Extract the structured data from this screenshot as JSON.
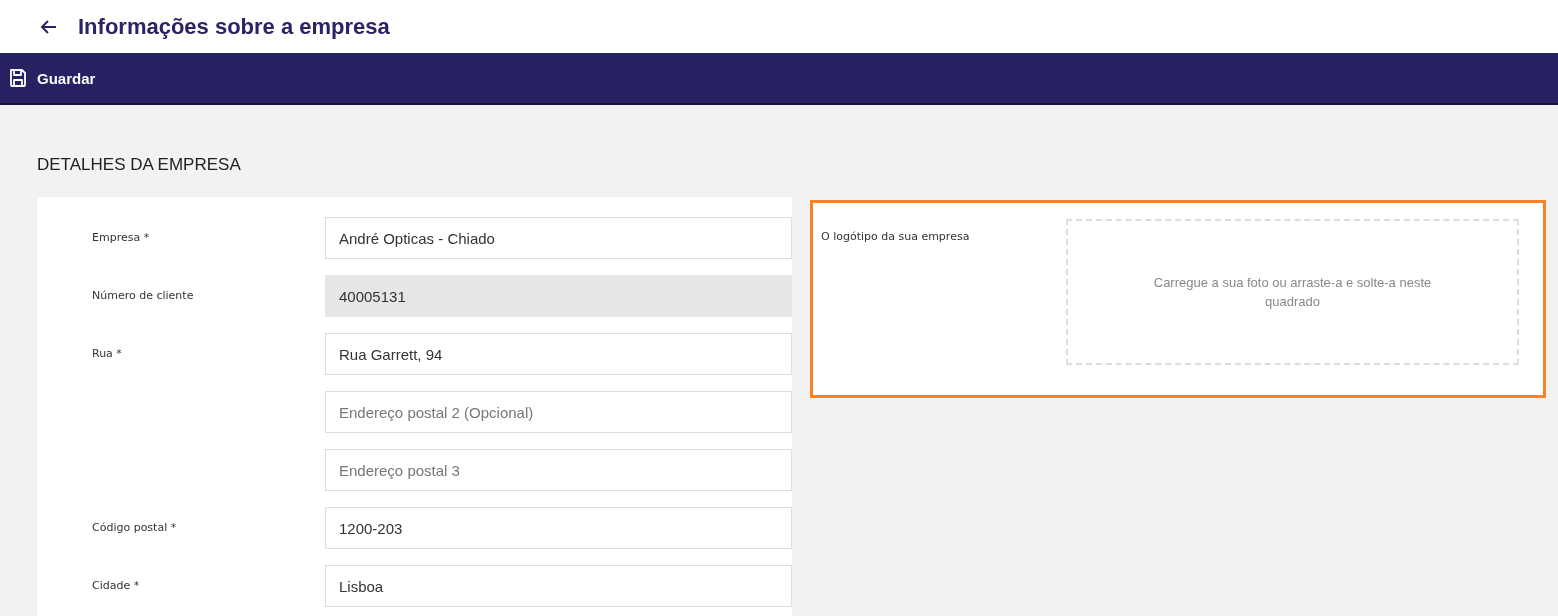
{
  "header": {
    "title": "Informações sobre a empresa"
  },
  "toolbar": {
    "save_label": "Guardar"
  },
  "section": {
    "title": "DETALHES DA EMPRESA"
  },
  "fields": [
    {
      "label": "Empresa *",
      "value": "André Opticas - Chiado",
      "disabled": false
    },
    {
      "label": "Número de cliente",
      "value": "40005131",
      "disabled": true
    },
    {
      "label": "Rua *",
      "value": "Rua Garrett, 94",
      "disabled": false
    },
    {
      "placeholder": "Endereço postal 2 (Opcional)",
      "disabled": false
    },
    {
      "placeholder": "Endereço postal 3",
      "disabled": false
    },
    {
      "label": "Código postal *",
      "value": "1200-203",
      "disabled": false
    },
    {
      "label": "Cidade *",
      "value": "Lisboa",
      "disabled": false
    }
  ],
  "logo": {
    "label": "O logótipo da sua empresa",
    "dropzone_text": "Carregue a sua foto ou arraste-a e solte-a neste quadrado",
    "highlighted": true
  }
}
